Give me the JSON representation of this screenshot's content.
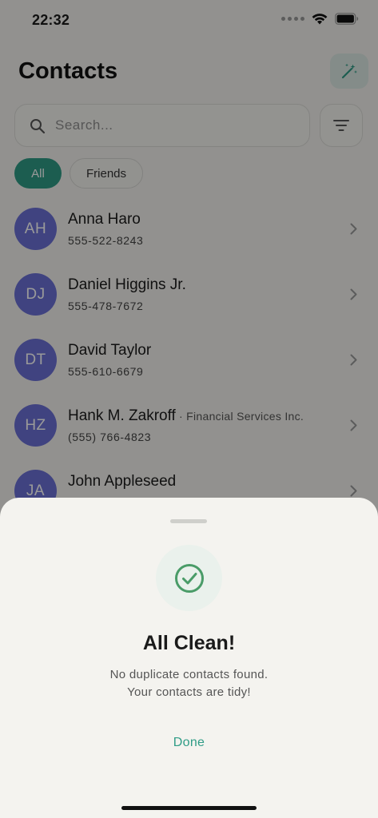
{
  "status_bar": {
    "time": "22:32"
  },
  "header": {
    "title": "Contacts"
  },
  "search": {
    "placeholder": "Search..."
  },
  "chips": {
    "all": "All",
    "friends": "Friends"
  },
  "contacts": [
    {
      "initials": "AH",
      "name": "Anna Haro",
      "company": "",
      "phone": "555-522-8243"
    },
    {
      "initials": "DJ",
      "name": "Daniel Higgins Jr.",
      "company": "",
      "phone": "555-478-7672"
    },
    {
      "initials": "DT",
      "name": "David Taylor",
      "company": "",
      "phone": "555-610-6679"
    },
    {
      "initials": "HZ",
      "name": "Hank M. Zakroff",
      "company": " · Financial Services Inc.",
      "phone": "(555) 766-4823"
    },
    {
      "initials": "JA",
      "name": "John Appleseed",
      "company": "",
      "phone": ""
    }
  ],
  "sheet": {
    "title": "All Clean!",
    "message_line1": "No duplicate contacts found.",
    "message_line2": "Your contacts are tidy!",
    "done_label": "Done"
  },
  "colors": {
    "accent": "#2f9c86",
    "avatar": "#6c71d6",
    "success": "#4a9c68"
  }
}
